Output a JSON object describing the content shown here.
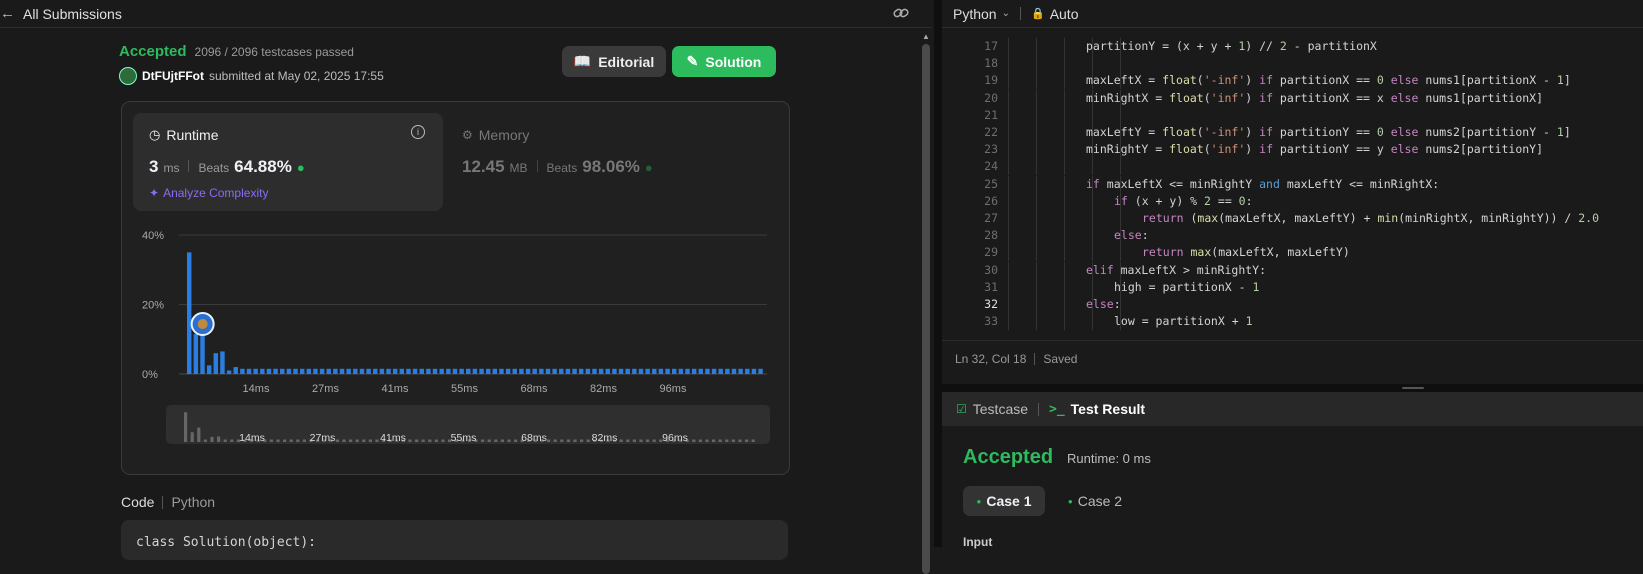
{
  "nav": {
    "back_label": "All Submissions"
  },
  "submission": {
    "status": "Accepted",
    "testcases": "2096 / 2096 testcases passed",
    "user": "DtFUjtFFot",
    "submitted_at": "submitted at May 02, 2025 17:55",
    "editorial_label": "Editorial",
    "solution_label": "Solution"
  },
  "runtime": {
    "title": "Runtime",
    "value": "3",
    "unit": "ms",
    "beats_label": "Beats",
    "beats": "64.88%",
    "analyze_label": "Analyze Complexity"
  },
  "memory": {
    "title": "Memory",
    "value": "12.45",
    "unit": "MB",
    "beats_label": "Beats",
    "beats": "98.06%"
  },
  "chart_data": {
    "type": "bar",
    "ylabel_ticks": [
      "40%",
      "20%",
      "0%"
    ],
    "ylim": [
      0,
      40
    ],
    "x_ticks": [
      "14ms",
      "27ms",
      "41ms",
      "55ms",
      "68ms",
      "82ms",
      "96ms"
    ],
    "values": [
      35,
      11.5,
      17,
      2.5,
      6,
      6.5,
      1,
      2,
      1.5,
      1.5,
      1.5,
      1.5,
      1.5,
      1.5,
      1.5,
      1.5,
      1.5,
      1.5,
      1.5,
      1.5,
      1.5,
      1.5,
      1.5,
      1.5,
      1.5,
      1.5,
      1.5,
      1.5,
      1.5,
      1.5,
      1.5,
      1.5,
      1.5,
      1.5,
      1.5,
      1.5,
      1.5,
      1.5,
      1.5,
      1.5,
      1.5,
      1.5,
      1.5,
      1.5,
      1.5,
      1.5,
      1.5,
      1.5,
      1.5,
      1.5,
      1.5,
      1.5,
      1.5,
      1.5,
      1.5,
      1.5,
      1.5,
      1.5,
      1.5,
      1.5,
      1.5,
      1.5,
      1.5,
      1.5,
      1.5,
      1.5,
      1.5,
      1.5,
      1.5,
      1.5,
      1.5,
      1.5,
      1.5,
      1.5,
      1.5,
      1.5,
      1.5,
      1.5,
      1.5,
      1.5,
      1.5,
      1.5,
      1.5,
      1.5,
      1.5,
      1.5,
      1.5
    ],
    "highlight_index": 1,
    "bar_color": "#2a7de1",
    "grid": true
  },
  "code_section": {
    "label": "Code",
    "lang": "Python",
    "first_line": "class Solution(object):"
  },
  "editor": {
    "language": "Python",
    "mode": "Auto",
    "status_pos": "Ln 32, Col 18",
    "status_saved": "Saved",
    "lines": [
      {
        "n": "17",
        "indent": 3,
        "text": "partitionY = (x + y + 1) // 2 - partitionX"
      },
      {
        "n": "18",
        "indent": 0,
        "text": ""
      },
      {
        "n": "19",
        "indent": 3,
        "text": "maxLeftX = float('-inf') if partitionX == 0 else nums1[partitionX - 1]"
      },
      {
        "n": "20",
        "indent": 3,
        "text": "minRightX = float('inf') if partitionX == x else nums1[partitionX]"
      },
      {
        "n": "21",
        "indent": 0,
        "text": ""
      },
      {
        "n": "22",
        "indent": 3,
        "text": "maxLeftY = float('-inf') if partitionY == 0 else nums2[partitionY - 1]"
      },
      {
        "n": "23",
        "indent": 3,
        "text": "minRightY = float('inf') if partitionY == y else nums2[partitionY]"
      },
      {
        "n": "24",
        "indent": 0,
        "text": ""
      },
      {
        "n": "25",
        "indent": 3,
        "text": "if maxLeftX <= minRightY and maxLeftY <= minRightX:"
      },
      {
        "n": "26",
        "indent": 4,
        "text": "if (x + y) % 2 == 0:"
      },
      {
        "n": "27",
        "indent": 5,
        "text": "return (max(maxLeftX, maxLeftY) + min(minRightX, minRightY)) / 2.0"
      },
      {
        "n": "28",
        "indent": 4,
        "text": "else:"
      },
      {
        "n": "29",
        "indent": 5,
        "text": "return max(maxLeftX, maxLeftY)"
      },
      {
        "n": "30",
        "indent": 3,
        "text": "elif maxLeftX > minRightY:"
      },
      {
        "n": "31",
        "indent": 4,
        "text": "high = partitionX - 1"
      },
      {
        "n": "32",
        "indent": 3,
        "text": "else:"
      },
      {
        "n": "33",
        "indent": 4,
        "text": "low = partitionX + 1"
      }
    ]
  },
  "bottom": {
    "tab_testcase": "Testcase",
    "tab_result": "Test Result",
    "status": "Accepted",
    "runtime": "Runtime: 0 ms",
    "case1": "Case 1",
    "case2": "Case 2",
    "input_label": "Input"
  },
  "colors": {
    "accent_green": "#2cbb5d",
    "button_green": "#2cbb5d",
    "blue": "#2a7de1"
  }
}
